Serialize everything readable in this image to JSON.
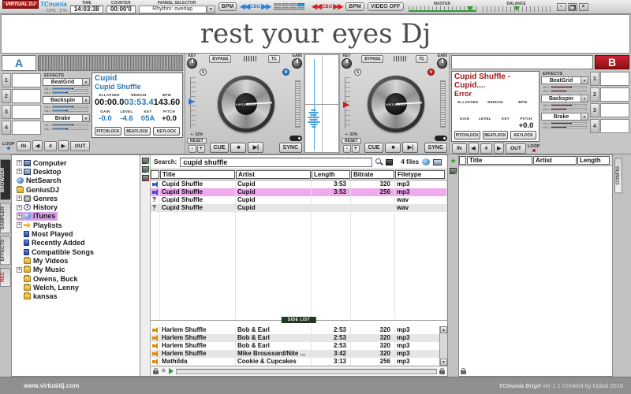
{
  "colors": {
    "blue": "#2b77b5",
    "red": "#a01818",
    "selpink": "#f0a8ee",
    "treesel": "#d9a0e8",
    "green": "#2e9e2e",
    "fxblue": "#4a7dae",
    "fxred": "#8a2020",
    "orange": "#e08a00"
  },
  "topbar": {
    "logo": "VIRTUAL DJ",
    "skin": "TCmania",
    "cpu": "CPU : 3 %",
    "time_label": "TIME",
    "time_value": "14:03:38",
    "counter_label": "COUNTER",
    "counter_value": "00:00'0",
    "panel_label": "PANNEL SELECTOR",
    "panel_value": "Rhythm: overlap",
    "bpm_left": "BPM",
    "bpm_right": "BPM",
    "cbg_left": "CBG",
    "cbg_right": "CBG",
    "video": "VIDEO OFF",
    "master": "MASTER",
    "balance": "BALANCE",
    "beat_cells": [
      {
        "cls": ""
      },
      {
        "cls": ""
      },
      {
        "cls": ""
      },
      {
        "cls": "on"
      },
      {
        "cls": ""
      },
      {
        "cls": ""
      },
      {
        "cls": ""
      },
      {
        "cls": ""
      }
    ]
  },
  "banner": {
    "text": "rest your eyes Dj"
  },
  "deck_a": {
    "label": "A",
    "artist": "Cupid",
    "title": "Cupid Shuffle",
    "effects_title": "EFFECTS",
    "fx": [
      {
        "name": "BeatGrid",
        "cls": "bfill",
        "v1": "VAL1",
        "v2": "VAL2"
      },
      {
        "name": "Backspin",
        "cls": "bfill",
        "v1": "VAL1",
        "v2": "VAL2"
      },
      {
        "name": "Brake",
        "cls": "bfill",
        "v1": "VAL1",
        "v2": "VAL2"
      }
    ],
    "slots": [
      {
        "n": "1"
      },
      {
        "n": "2"
      },
      {
        "n": "3"
      },
      {
        "n": "4"
      }
    ],
    "stats1": [
      {
        "l": "ELLAPSED",
        "v": "00:00.0",
        "cls": "dk"
      },
      {
        "l": "REMAIN",
        "v": "03:53.4",
        "cls": "bl"
      },
      {
        "l": "BPM",
        "v": "143.60",
        "cls": "dk"
      }
    ],
    "stats2": [
      {
        "l": "GAIN",
        "v": "-0.0",
        "cls": "bl"
      },
      {
        "l": "LEVEL",
        "v": "-4.6",
        "cls": "bl"
      },
      {
        "l": "KEY",
        "v": "05A",
        "cls": "bl"
      },
      {
        "l": "PITCH",
        "v": "+0.0",
        "cls": "dk"
      }
    ],
    "locks": [
      {
        "l": "PITCHLOCK"
      },
      {
        "l": "BEATLOCK"
      },
      {
        "l": "KEYLOCK"
      }
    ],
    "loop_label": "LOOP",
    "in": "IN",
    "loop_num": "4",
    "out": "OUT"
  },
  "deck_b": {
    "label": "B",
    "title_line": "Cupid Shuffle - Cupid....",
    "error": "Error",
    "effects_title": "EFFECTS",
    "fx": [
      {
        "name": "BeatGrid",
        "cls": "rfill",
        "v1": "VAL1",
        "v2": "VAL2"
      },
      {
        "name": "Backspin",
        "cls": "rfill",
        "v1": "VAL1",
        "v2": "VAL2"
      },
      {
        "name": "Brake",
        "cls": "rfill",
        "v1": "VAL1",
        "v2": "VAL2"
      }
    ],
    "slots": [
      {
        "n": "1"
      },
      {
        "n": "2"
      },
      {
        "n": "3"
      },
      {
        "n": "4"
      }
    ],
    "stats1": [
      {
        "l": "ELLAPSED",
        "v": "",
        "cls": "dk"
      },
      {
        "l": "REMAIN",
        "v": "",
        "cls": "dk"
      },
      {
        "l": "BPM",
        "v": "",
        "cls": "dk"
      }
    ],
    "stats2": [
      {
        "l": "GAIN",
        "v": "",
        "cls": "dk"
      },
      {
        "l": "LEVEL",
        "v": "",
        "cls": "dk"
      },
      {
        "l": "KEY",
        "v": "",
        "cls": "dk"
      },
      {
        "l": "PITCH",
        "v": "+0.0",
        "cls": "dk"
      }
    ],
    "locks": [
      {
        "l": "PITCHLOCK"
      },
      {
        "l": "BEATLOCK"
      },
      {
        "l": "KEYLOCK"
      }
    ],
    "loop_label": "LOOP",
    "in": "IN",
    "loop_num": "4",
    "out": "OUT"
  },
  "tt_left": {
    "key": "KEY",
    "bypass": "BYPASS",
    "tc": "TC",
    "gain": "GAIN",
    "s": "S",
    "v": "V",
    "brand": "VIRTUALDJ",
    "range": "+- 32%",
    "reset": "RESET",
    "minus": "-",
    "plus": "+",
    "cue": "CUE",
    "stop": "■",
    "play": "▶|",
    "sync": "SYNC"
  },
  "tt_right": {
    "key": "KEY",
    "bypass": "BYPASS",
    "tc": "TC",
    "gain": "GAIN",
    "s": "S",
    "v": "V",
    "brand": "VIRTUALDJ",
    "range": "+- 33%",
    "reset": "RESET",
    "minus": "-",
    "plus": "+",
    "cue": "CUE",
    "stop": "■",
    "play": "▶|",
    "sync": "SYNC"
  },
  "browser": {
    "tabs": [
      {
        "label": "BROWSER",
        "cls": "act"
      },
      {
        "label": "SAMPLER",
        "cls": ""
      },
      {
        "label": "EFFECTS",
        "cls": ""
      },
      {
        "label": "REC",
        "cls": "rec"
      }
    ],
    "tree": [
      {
        "label": "Computer",
        "exp": "+",
        "kind": "computer",
        "cls": ""
      },
      {
        "label": "Desktop",
        "exp": "+",
        "kind": "desktop",
        "cls": ""
      },
      {
        "label": "NetSearch",
        "exp": "",
        "kind": "globe",
        "cls": "noexp"
      },
      {
        "label": "GeniusDJ",
        "exp": "",
        "kind": "gfolder",
        "cls": "noexp"
      },
      {
        "label": "Genres",
        "exp": "+",
        "kind": "genres",
        "cls": ""
      },
      {
        "label": "History",
        "exp": "+",
        "kind": "clock",
        "cls": ""
      },
      {
        "label": "iTunes",
        "exp": "+",
        "kind": "itunes",
        "cls": "sel"
      },
      {
        "label": "Playlists",
        "exp": "+",
        "kind": "playlist",
        "cls": ""
      },
      {
        "label": "Most Played",
        "exp": "",
        "kind": "doc",
        "cls": ""
      },
      {
        "label": "Recently Added",
        "exp": "",
        "kind": "doc",
        "cls": ""
      },
      {
        "label": "Compatible Songs",
        "exp": "",
        "kind": "doc",
        "cls": ""
      },
      {
        "label": "My Videos",
        "exp": "",
        "kind": "folder",
        "cls": ""
      },
      {
        "label": "My Music",
        "exp": "+",
        "kind": "folder",
        "cls": ""
      },
      {
        "label": "Owens, Buck",
        "exp": "",
        "kind": "folder",
        "cls": ""
      },
      {
        "label": "Welch, Lenny",
        "exp": "",
        "kind": "folder",
        "cls": ""
      },
      {
        "label": "kansas",
        "exp": "",
        "kind": "folder",
        "cls": ""
      }
    ],
    "search_label": "Search:",
    "search_value": "cupid shuffle",
    "files_count": "4 files",
    "columns": [
      {
        "label": ""
      },
      {
        "label": "Title"
      },
      {
        "label": "Artist"
      },
      {
        "label": "Length"
      },
      {
        "label": "Bitrate"
      },
      {
        "label": "Filetype"
      }
    ],
    "rows": [
      {
        "ic": "spk b",
        "it": "",
        "title": "Cupid Shuffle",
        "artist": "Cupid",
        "length": "3:53",
        "bitrate": "320",
        "filetype": "mp3",
        "cls": ""
      },
      {
        "ic": "spk b",
        "it": "",
        "title": "Cupid Shuffle",
        "artist": "Cupid",
        "length": "3:53",
        "bitrate": "256",
        "filetype": "mp3",
        "cls": "sel"
      },
      {
        "ic": "",
        "it": "?",
        "title": "Cupid Shuffle",
        "artist": "Cupid",
        "length": "",
        "bitrate": "",
        "filetype": "wav",
        "cls": ""
      },
      {
        "ic": "",
        "it": "?",
        "title": "Cupid Shuffle",
        "artist": "Cupid",
        "length": "",
        "bitrate": "",
        "filetype": "wav",
        "cls": "alt"
      }
    ],
    "side_list_label": "SIDE LIST",
    "side_rows": [
      {
        "ic": "spk o",
        "it": "",
        "title": "Harlem Shuffle",
        "artist": "Bob & Earl",
        "length": "2:53",
        "bitrate": "320",
        "filetype": "mp3",
        "cls": ""
      },
      {
        "ic": "spk o",
        "it": "",
        "title": "Harlem Shuffle",
        "artist": "Bob & Earl",
        "length": "2:53",
        "bitrate": "320",
        "filetype": "mp3",
        "cls": "alt"
      },
      {
        "ic": "spk o",
        "it": "",
        "title": "Harlem Shuffle",
        "artist": "Bob & Earl",
        "length": "2:53",
        "bitrate": "320",
        "filetype": "mp3",
        "cls": ""
      },
      {
        "ic": "spk o",
        "it": "",
        "title": "Harlem Shuffle",
        "artist": "Mike Broussard/Nite ...",
        "length": "3:42",
        "bitrate": "320",
        "filetype": "mp3",
        "cls": "alt"
      },
      {
        "ic": "spk o",
        "it": "",
        "title": "Mathilda",
        "artist": "Cookie & Cupcakes",
        "length": "3:13",
        "bitrate": "256",
        "filetype": "mp3",
        "cls": ""
      }
    ],
    "right_columns": [
      {
        "label": ""
      },
      {
        "label": "Title"
      },
      {
        "label": "Artist"
      },
      {
        "label": "Length"
      }
    ],
    "config_tab": "CONFIG"
  },
  "footer": {
    "url": "www.virtualdj.com",
    "credit_name": "TCmania Brigit",
    "credit_rest": " ver 1.1 Created by Djdad 2010"
  }
}
